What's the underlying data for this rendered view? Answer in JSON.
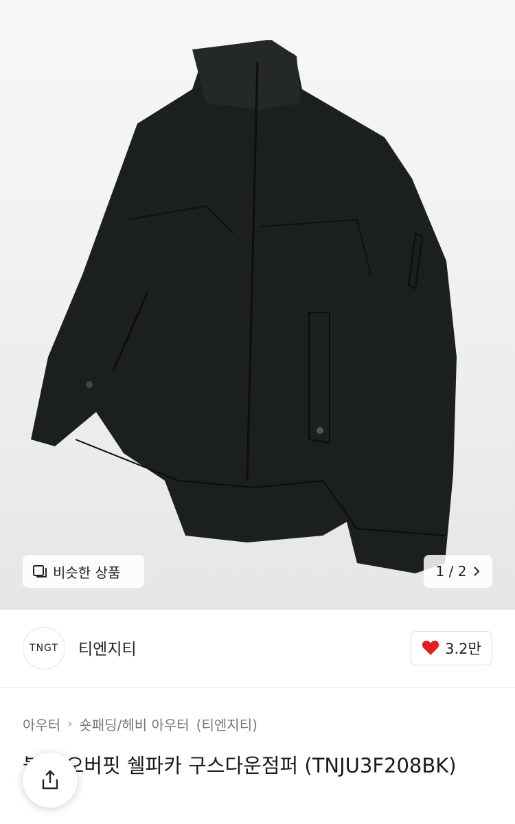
{
  "gallery": {
    "similar_label": "비슷한 상품",
    "pager": "1 / 2"
  },
  "seller": {
    "logo_text": "TNGT",
    "name": "티엔지티",
    "likes": "3.2만"
  },
  "breadcrumb": {
    "category": "아우터",
    "subcategory": "숏패딩/헤비 아우터",
    "brand": "(티엔지티)"
  },
  "product": {
    "title": "블랙 오버핏 쉘파카 구스다운점퍼 (TNJU3F208BK)"
  },
  "colors": {
    "heart": "#e02020"
  }
}
